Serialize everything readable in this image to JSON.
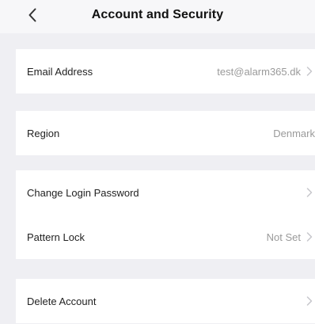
{
  "header": {
    "title": "Account and Security"
  },
  "sections": [
    {
      "rows": [
        {
          "label": "Email Address",
          "value": "test@alarm365.dk",
          "chevron": true
        }
      ]
    },
    {
      "rows": [
        {
          "label": "Region",
          "value": "Denmark",
          "chevron": false
        }
      ]
    },
    {
      "rows": [
        {
          "label": "Change Login Password",
          "value": "",
          "chevron": true
        },
        {
          "label": "Pattern Lock",
          "value": "Not Set",
          "chevron": true
        }
      ]
    },
    {
      "rows": [
        {
          "label": "Delete Account",
          "value": "",
          "chevron": true
        }
      ]
    }
  ],
  "icons": {
    "back": "back-arrow-icon",
    "chevron": "chevron-right-icon"
  },
  "colors": {
    "page_background": "#efeff3",
    "surface": "#ffffff",
    "primary_text": "#222222",
    "secondary_text": "#9a9a9a"
  }
}
